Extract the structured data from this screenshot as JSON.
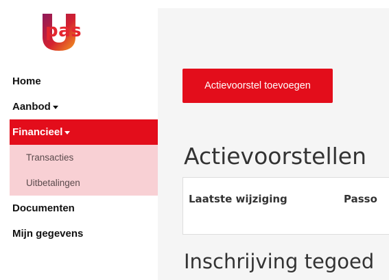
{
  "brand": {
    "name": "pas"
  },
  "sidebar": {
    "items": [
      {
        "label": "Home"
      },
      {
        "label": "Aanbod"
      },
      {
        "label": "Financieel"
      },
      {
        "label": "Documenten"
      },
      {
        "label": "Mijn gegevens"
      }
    ],
    "financieel_sub": [
      {
        "label": "Transacties"
      },
      {
        "label": "Uitbetalingen"
      }
    ]
  },
  "main": {
    "add_button": "Actievoorstel toevoegen",
    "section1_title": "Actievoorstellen",
    "table_headers": [
      "Laatste wijziging",
      "Passo"
    ],
    "section2_title": "Inschrijving tegoed"
  },
  "colors": {
    "accent": "#e30d1b",
    "subnav_bg": "#f8d0d4",
    "main_bg": "#f5f5f5"
  }
}
